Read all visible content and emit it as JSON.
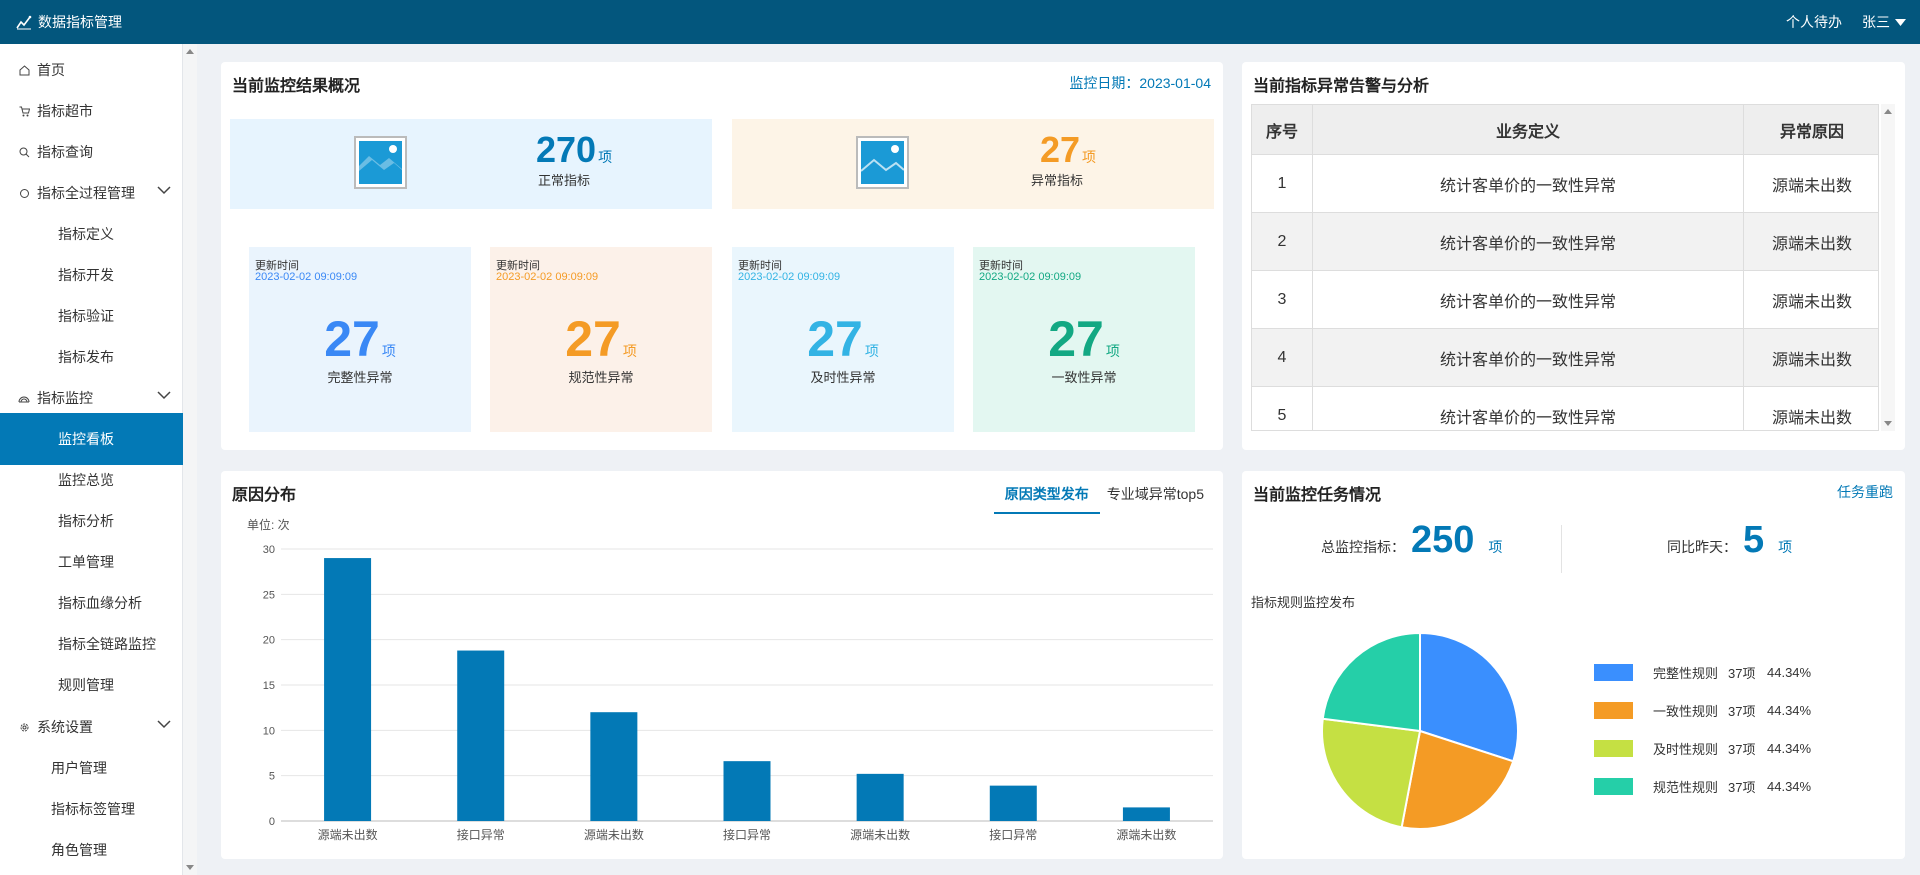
{
  "header": {
    "title": "数据指标管理",
    "todo": "个人待办",
    "user": "张三"
  },
  "sidebar": {
    "items": [
      {
        "label": "首页",
        "icon": "home-icon"
      },
      {
        "label": "指标超市",
        "icon": "cart-icon"
      },
      {
        "label": "指标查询",
        "icon": "search-icon"
      },
      {
        "label": "指标全过程管理",
        "icon": "circle-icon"
      },
      {
        "label": "指标定义"
      },
      {
        "label": "指标开发"
      },
      {
        "label": "指标验证"
      },
      {
        "label": "指标发布"
      },
      {
        "label": "指标监控",
        "icon": "monitor-icon"
      },
      {
        "label": "监控看板"
      },
      {
        "label": "监控总览"
      },
      {
        "label": "指标分析"
      },
      {
        "label": "工单管理"
      },
      {
        "label": "指标血缘分析"
      },
      {
        "label": "指标全链路监控"
      },
      {
        "label": "规则管理"
      },
      {
        "label": "系统设置",
        "icon": "gear-icon"
      },
      {
        "label": "用户管理"
      },
      {
        "label": "指标标签管理"
      },
      {
        "label": "角色管理"
      }
    ]
  },
  "overview": {
    "title": "当前监控结果概况",
    "date_label": "监控日期：2023-01-04",
    "normal": {
      "value": "270",
      "unit": "项",
      "label": "正常指标"
    },
    "abnormal": {
      "value": "27",
      "unit": "项",
      "label": "异常指标"
    },
    "update_label": "更新时间",
    "cards": [
      {
        "time": "2023-02-02 09:09:09",
        "value": "27",
        "unit": "项",
        "label": "完整性异常",
        "color": "#3a88f5",
        "bg": "#eaf4fd"
      },
      {
        "time": "2023-02-02 09:09:09",
        "value": "27",
        "unit": "项",
        "label": "规范性异常",
        "color": "#f49b25",
        "bg": "#fcf1e9"
      },
      {
        "time": "2023-02-02 09:09:09",
        "value": "27",
        "unit": "项",
        "label": "及时性异常",
        "color": "#33b3e4",
        "bg": "#eaf6fd"
      },
      {
        "time": "2023-02-02 09:09:09",
        "value": "27",
        "unit": "项",
        "label": "一致性异常",
        "color": "#13a883",
        "bg": "#e3f7f1"
      }
    ]
  },
  "alerts": {
    "title": "当前指标异常告警与分析",
    "columns": [
      "序号",
      "业务定义",
      "异常原因"
    ],
    "rows": [
      [
        "1",
        "统计客单价的一致性异常",
        "源端未出数"
      ],
      [
        "2",
        "统计客单价的一致性异常",
        "源端未出数"
      ],
      [
        "3",
        "统计客单价的一致性异常",
        "源端未出数"
      ],
      [
        "4",
        "统计客单价的一致性异常",
        "源端未出数"
      ],
      [
        "5",
        "统计客单价的一致性异常",
        "源端未出数"
      ]
    ]
  },
  "reasons": {
    "title": "原因分布",
    "tabs": [
      "原因类型发布",
      "专业域异常top5"
    ],
    "unit_label": "单位: 次"
  },
  "chart_data": {
    "type": "bar",
    "categories": [
      "源端未出数",
      "接口异常",
      "源端未出数",
      "接口异常",
      "源端未出数",
      "接口异常",
      "源端未出数"
    ],
    "values": [
      29,
      18.8,
      12,
      6.6,
      5.2,
      3.9,
      1.5
    ],
    "yticks": [
      0,
      5,
      10,
      15,
      20,
      25,
      30
    ],
    "ylim": [
      0,
      30
    ],
    "color": "#0379b6",
    "grid": true
  },
  "tasks": {
    "title": "当前监控任务情况",
    "rerun": "任务重跑",
    "total_label": "总监控指标：",
    "total_value": "250",
    "total_unit": "项",
    "yoy_label": "同比昨天：",
    "yoy_value": "5",
    "yoy_unit": "项",
    "pie_title": "指标规则监控发布",
    "pie": [
      {
        "name": "完整性规则",
        "count": "37项",
        "percent": "44.34%",
        "share": 0.3,
        "color": "#3a8ffe"
      },
      {
        "name": "一致性规则",
        "count": "37项",
        "percent": "44.34%",
        "share": 0.23,
        "color": "#f49b25"
      },
      {
        "name": "及时性规则",
        "count": "37项",
        "percent": "44.34%",
        "share": 0.24,
        "color": "#c5e043"
      },
      {
        "name": "规范性规则",
        "count": "37项",
        "percent": "44.34%",
        "share": 0.23,
        "color": "#25cfa8"
      }
    ]
  }
}
